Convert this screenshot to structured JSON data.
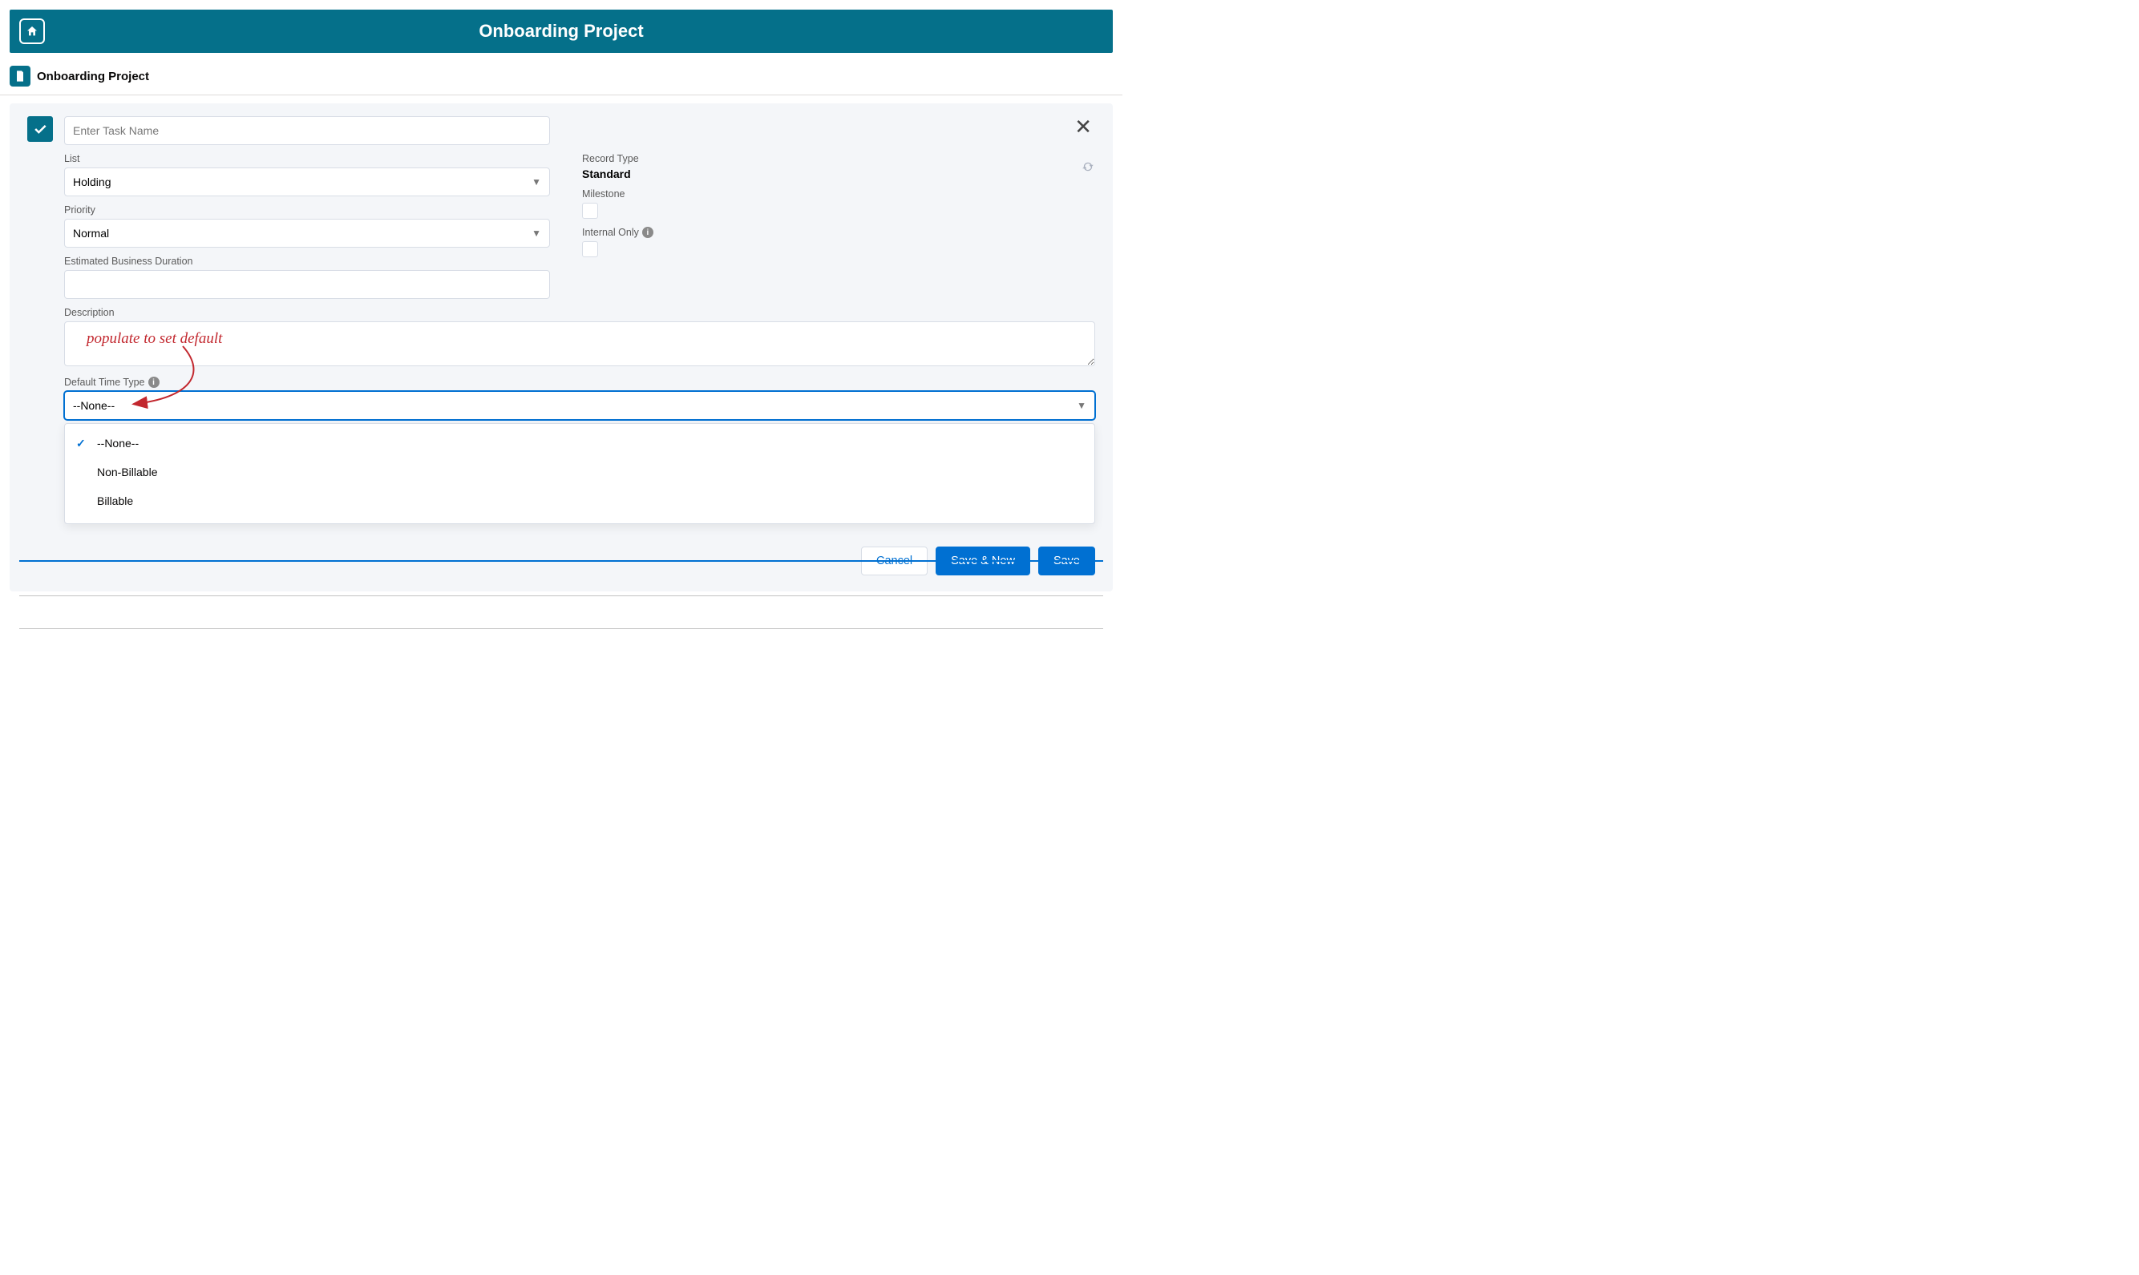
{
  "header": {
    "title": "Onboarding Project"
  },
  "context": {
    "record_title": "Onboarding Project"
  },
  "task": {
    "name_placeholder": "Enter Task Name",
    "list_label": "List",
    "list_value": "Holding",
    "priority_label": "Priority",
    "priority_value": "Normal",
    "duration_label": "Estimated Business Duration",
    "duration_value": "",
    "record_type_label": "Record Type",
    "record_type_value": "Standard",
    "milestone_label": "Milestone",
    "internal_only_label": "Internal Only",
    "description_label": "Description",
    "description_value": "",
    "default_time_type_label": "Default Time Type",
    "default_time_type_value": "--None--",
    "default_time_type_options": [
      "--None--",
      "Non-Billable",
      "Billable"
    ]
  },
  "annotation": {
    "text": "populate to set default"
  },
  "footer": {
    "cancel": "Cancel",
    "save_new": "Save & New",
    "save": "Save"
  }
}
